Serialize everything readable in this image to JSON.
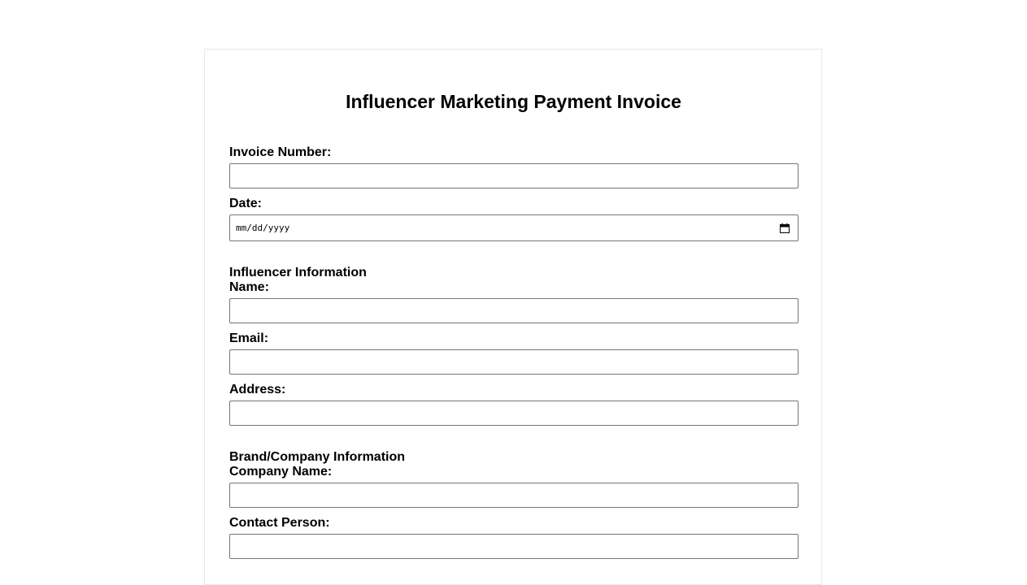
{
  "form": {
    "title": "Influencer Marketing Payment Invoice",
    "invoice_number_label": "Invoice Number:",
    "invoice_number_value": "",
    "date_label": "Date:",
    "date_placeholder": "mm/dd/yyyy",
    "date_icon": "calendar-icon"
  },
  "influencer": {
    "heading": "Influencer Information",
    "name_label": "Name:",
    "name_value": "",
    "email_label": "Email:",
    "email_value": "",
    "address_label": "Address:",
    "address_value": ""
  },
  "brand": {
    "heading": "Brand/Company Information",
    "company_name_label": "Company Name:",
    "company_name_value": "",
    "contact_person_label": "Contact Person:",
    "contact_person_value": ""
  }
}
